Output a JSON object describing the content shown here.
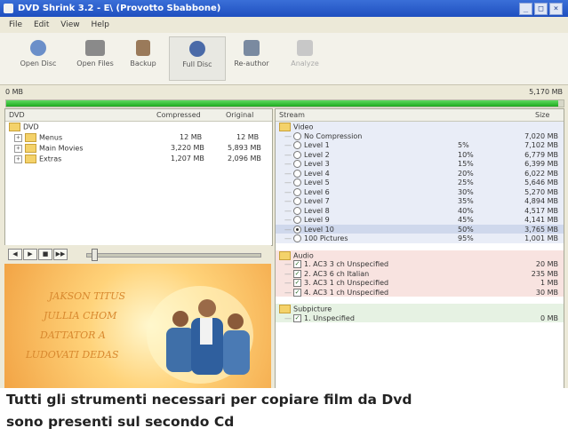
{
  "window": {
    "title": "DVD Shrink 3.2 - E\\ (Provotto Sbabbone)",
    "min": "_",
    "max": "□",
    "close": "×"
  },
  "menu": [
    "File",
    "Edit",
    "View",
    "Help"
  ],
  "toolbar": [
    {
      "label": "Open Disc",
      "icon": "disc-icon",
      "color": "#6b8fc9"
    },
    {
      "label": "Open Files",
      "icon": "files-icon",
      "color": "#8a8a8a"
    },
    {
      "label": "Backup",
      "icon": "backup-icon",
      "color": "#9a7a5a"
    },
    {
      "label": "Full Disc",
      "icon": "fulldisc-icon",
      "color": "#4a6aa8"
    },
    {
      "label": "Re-author",
      "icon": "reauthor-icon",
      "color": "#7a8aa0"
    },
    {
      "label": "Analyze",
      "icon": "analyze-icon",
      "color": "#c8c8c8"
    }
  ],
  "status": {
    "left": "0 MB",
    "right": "5,170 MB",
    "progress_fraction": 0.99,
    "accent": "#1ea91e"
  },
  "left_table": {
    "headers": [
      "DVD",
      "Compressed",
      "Original"
    ],
    "rows": [
      {
        "name": "DVD",
        "compressed": "",
        "original": ""
      },
      {
        "name": "Menus",
        "compressed": "12 MB",
        "original": "12 MB"
      },
      {
        "name": "Main Movies",
        "compressed": "3,220 MB",
        "original": "5,893 MB"
      },
      {
        "name": "Extras",
        "compressed": "1,207 MB",
        "original": "2,096 MB"
      }
    ]
  },
  "player": {
    "buttons": [
      "◀",
      "▶",
      "■",
      "▶▶"
    ]
  },
  "preview_lines": [
    "JAKSON TITUS",
    "JULLIA CHOM",
    "DATTATOR A",
    "LUDOVATI DEDAS"
  ],
  "right_table": {
    "headers": [
      "Stream",
      "Size"
    ],
    "video_label": "Video",
    "video_rows": [
      {
        "label": "No Compression",
        "pct": "",
        "size": "7,020 MB"
      },
      {
        "label": "Level 1",
        "pct": "5%",
        "size": "7,102 MB"
      },
      {
        "label": "Level 2",
        "pct": "10%",
        "size": "6,779 MB"
      },
      {
        "label": "Level 3",
        "pct": "15%",
        "size": "6,399 MB"
      },
      {
        "label": "Level 4",
        "pct": "20%",
        "size": "6,022 MB"
      },
      {
        "label": "Level 5",
        "pct": "25%",
        "size": "5,646 MB"
      },
      {
        "label": "Level 6",
        "pct": "30%",
        "size": "5,270 MB"
      },
      {
        "label": "Level 7",
        "pct": "35%",
        "size": "4,894 MB"
      },
      {
        "label": "Level 8",
        "pct": "40%",
        "size": "4,517 MB"
      },
      {
        "label": "Level 9",
        "pct": "45%",
        "size": "4,141 MB"
      },
      {
        "label": "Level 10",
        "pct": "50%",
        "size": "3,765 MB",
        "selected": true
      },
      {
        "label": "100 Pictures",
        "pct": "95%",
        "size": "1,001 MB"
      }
    ],
    "audio_label": "Audio",
    "audio_rows": [
      {
        "label": "1. AC3 3 ch Unspecified",
        "size": "20 MB"
      },
      {
        "label": "2. AC3 6 ch Italian",
        "size": "235 MB"
      },
      {
        "label": "3. AC3 1 ch Unspecified",
        "size": "1 MB"
      },
      {
        "label": "4. AC3 1 ch Unspecified",
        "size": "30 MB"
      }
    ],
    "sub_label": "Subpicture",
    "sub_rows": [
      {
        "label": "1. Unspecified",
        "size": "0 MB"
      }
    ]
  },
  "caption": [
    "Tutti gli strumenti necessari per copiare film da Dvd",
    "sono presenti sul secondo Cd"
  ]
}
